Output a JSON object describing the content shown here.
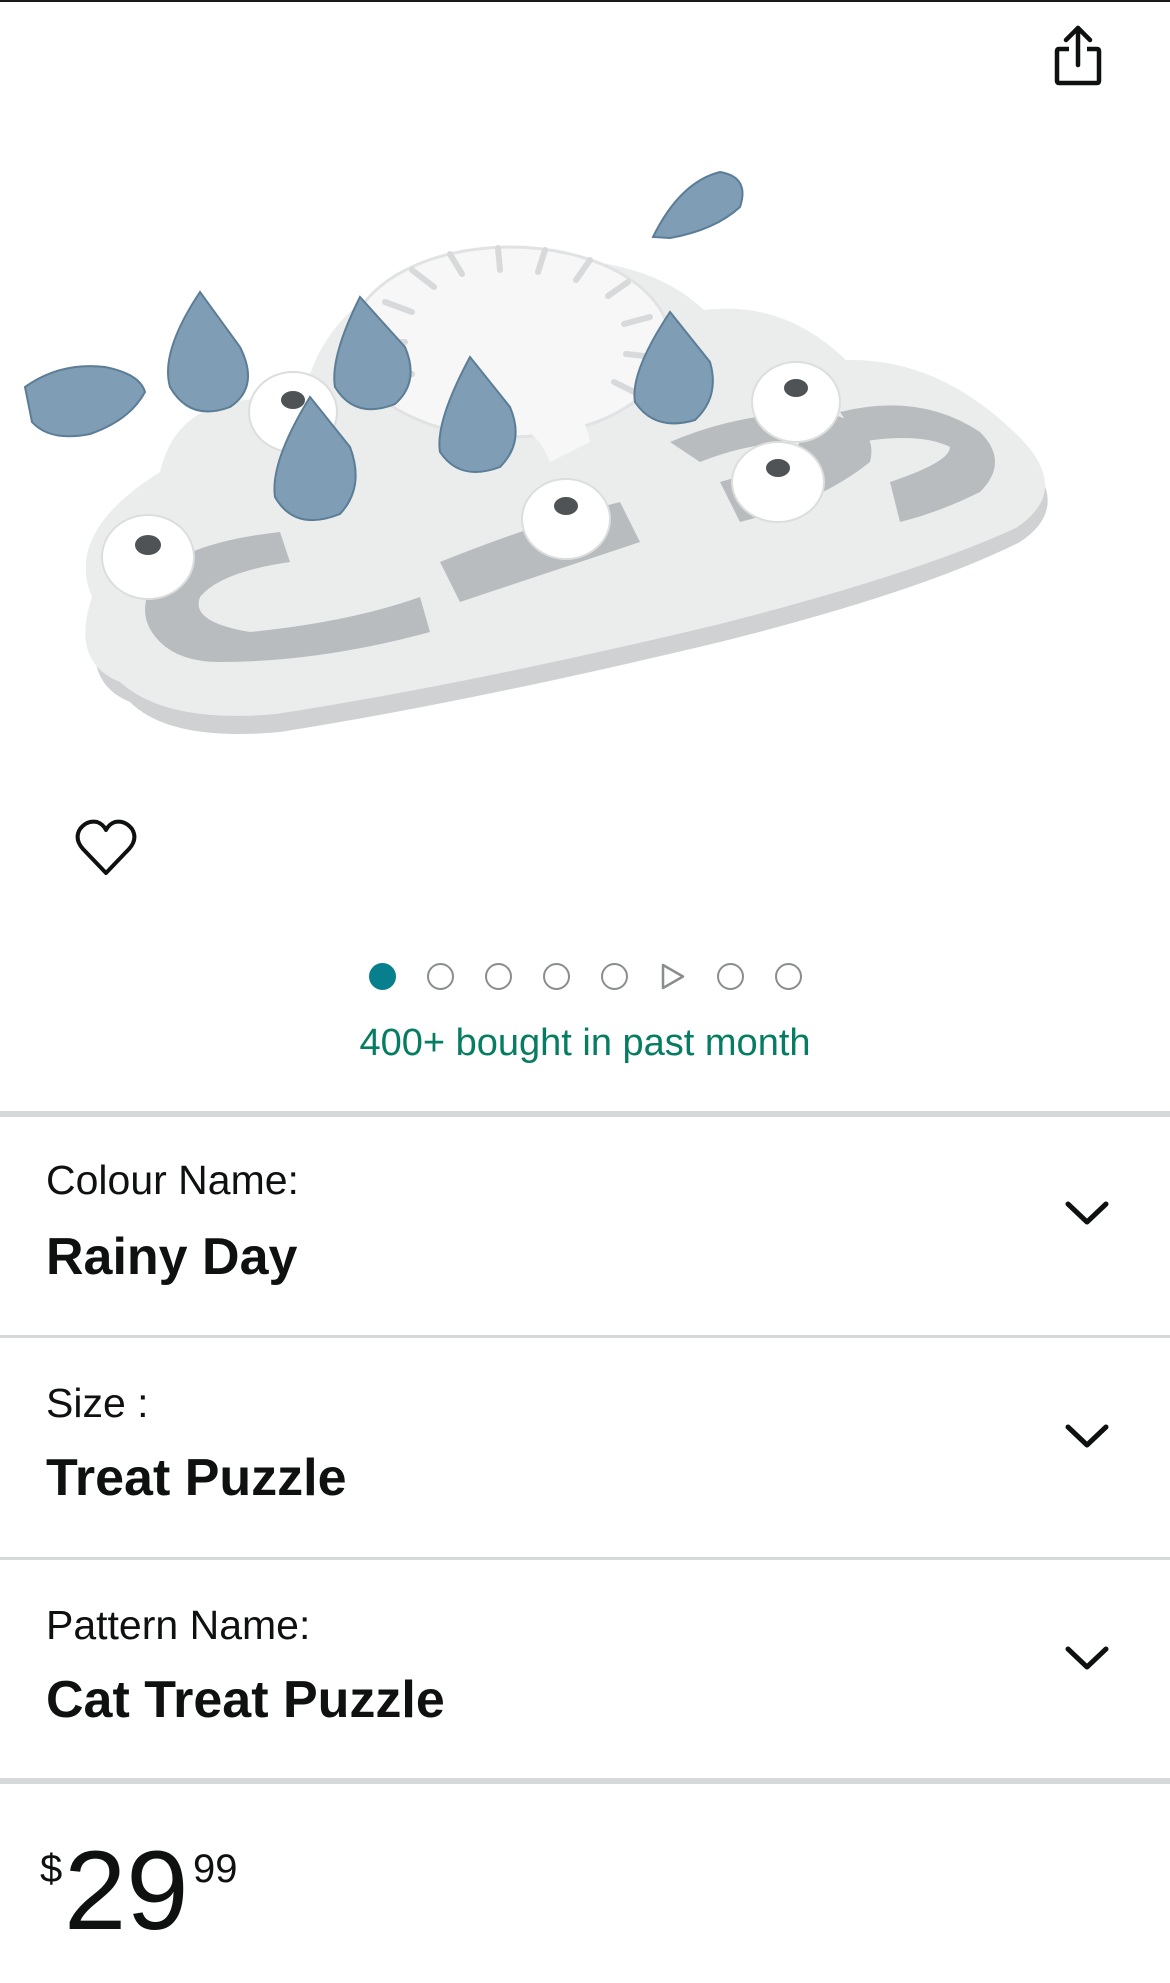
{
  "icons": {
    "share": "share-icon",
    "wishlist": "heart-icon",
    "video_dot": "play-icon",
    "dropdown": "chevron-down-icon"
  },
  "gallery": {
    "image_count": 8,
    "active_index": 0,
    "video_index": 5,
    "bought_text": "400+ bought in past month"
  },
  "variations": [
    {
      "label": "Colour Name:",
      "value": "Rainy Day"
    },
    {
      "label": "Size :",
      "value": "Treat Puzzle"
    },
    {
      "label": "Pattern Name:",
      "value": "Cat Treat Puzzle"
    }
  ],
  "price": {
    "symbol": "$",
    "whole": "29",
    "fraction": "99"
  },
  "colors": {
    "accent_teal": "#087f8c",
    "bought_green": "#067d62",
    "divider": "#d5d9d9",
    "text": "#0f1111"
  }
}
